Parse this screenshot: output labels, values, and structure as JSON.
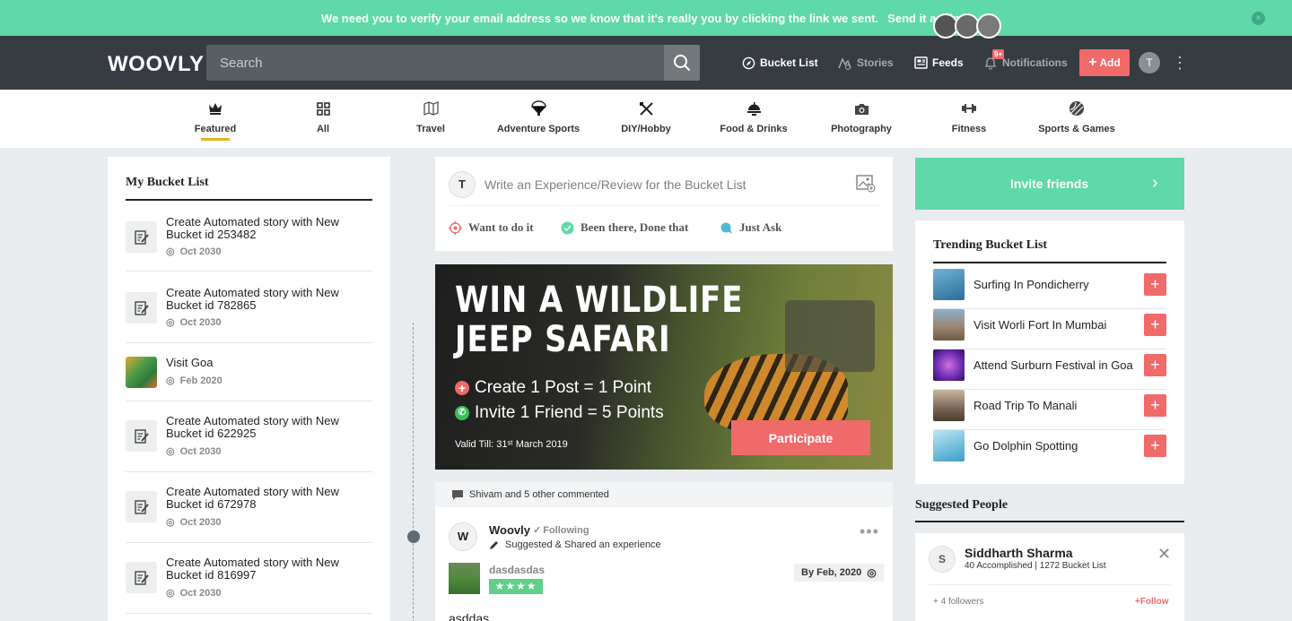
{
  "banner": {
    "message": "We need you to verify your email address so we know that it's really you by clicking the link we sent.",
    "link": "Send it again",
    "close": "×"
  },
  "navbar": {
    "logo": "WOOVLY",
    "search_placeholder": "Search",
    "links": {
      "bucket_list": "Bucket List",
      "stories": "Stories",
      "feeds": "Feeds",
      "notifications": "Notifications"
    },
    "notif_badge": "9+",
    "add_label": "Add",
    "avatar_initial": "T",
    "kebab": "⋮"
  },
  "categories": [
    {
      "label": "Featured"
    },
    {
      "label": "All"
    },
    {
      "label": "Travel"
    },
    {
      "label": "Adventure Sports"
    },
    {
      "label": "DIY/Hobby"
    },
    {
      "label": "Food & Drinks"
    },
    {
      "label": "Photography"
    },
    {
      "label": "Fitness"
    },
    {
      "label": "Sports & Games"
    }
  ],
  "left": {
    "title": "My Bucket List",
    "items": [
      {
        "title": "Create Automated story with New Bucket id 253482",
        "date": "Oct 2030"
      },
      {
        "title": "Create Automated story with New Bucket id 782865",
        "date": "Oct 2030"
      },
      {
        "title": "Visit Goa",
        "date": "Feb 2020"
      },
      {
        "title": "Create Automated story with New Bucket id 622925",
        "date": "Oct 2030"
      },
      {
        "title": "Create Automated story with New Bucket id 672978",
        "date": "Oct 2030"
      },
      {
        "title": "Create Automated story with New Bucket id 816997",
        "date": "Oct 2030"
      }
    ]
  },
  "composer": {
    "avatar_initial": "T",
    "placeholder": "Write an Experience/Review for the Bucket List",
    "options": {
      "want": "Want to do it",
      "been": "Been there, Done that",
      "ask": "Just Ask"
    }
  },
  "promo": {
    "title_line1": "WIN A WILDLIFE",
    "title_line2": "JEEP SAFARI",
    "line1": "Create 1 Post = 1 Point",
    "line2": "Invite 1 Friend = 5 Points",
    "valid": "Valid Till: 31ˢᵗ March 2019",
    "cta": "Participate"
  },
  "post": {
    "header": "Shivam and 5 other commented",
    "avatar_initial": "W",
    "author": "Woovly",
    "following": "Following",
    "action": "Suggested & Shared an experience",
    "more": "•••",
    "thumb_title": "dasdasdas",
    "stars": "★★★★",
    "date": "By Feb, 2020",
    "body": "asddas"
  },
  "right": {
    "invite_label": "Invite friends",
    "invite_arrow": "›",
    "trending_title": "Trending Bucket List",
    "trending": [
      {
        "label": "Surfing In Pondicherry",
        "color": "#3c86b5"
      },
      {
        "label": "Visit Worli Fort In Mumbai",
        "color": "#8a7a6a"
      },
      {
        "label": "Attend Surburn Festival in Goa",
        "color": "#7b3fc0"
      },
      {
        "label": "Road Trip To Manali",
        "color": "#7a6858"
      },
      {
        "label": "Go Dolphin Spotting",
        "color": "#4aa8d0"
      }
    ],
    "add_symbol": "+",
    "suggested_title": "Suggested People",
    "suggested": {
      "initial": "S",
      "name": "Siddharth Sharma",
      "stats": "40 Accomplished | 1272 Bucket List",
      "followers": "+ 4 followers",
      "follow": "+Follow",
      "close": "✕"
    }
  },
  "colors": {
    "accent_green": "#5fd9a8",
    "accent_red": "#f06a6a",
    "navbar": "#363c42",
    "underline": "#e6b422"
  }
}
